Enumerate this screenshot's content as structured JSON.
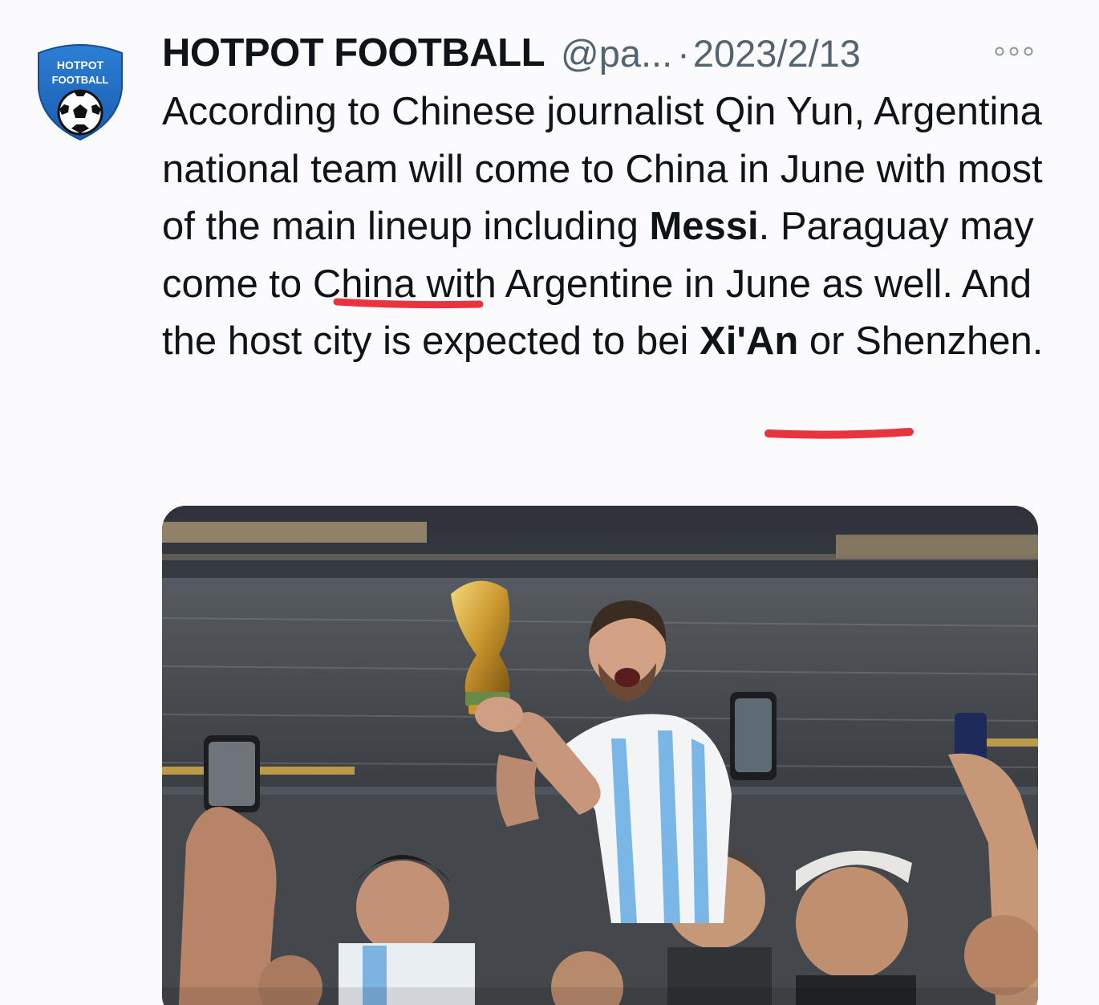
{
  "tweet": {
    "avatar": {
      "line1": "HOTPOT",
      "line2": "FOOTBALL",
      "icon": "soccer-ball-shield-logo"
    },
    "display_name": "HOTPOT FOOTBALL",
    "handle": "@pa...",
    "separator": "·",
    "date": "2023/2/13",
    "more_icon": "more-options-icon",
    "text": {
      "part1": "According to Chinese journalist Qin Yun, Argentina national team will come to China in June with most of the main lineup including ",
      "highlight1": "Messi",
      "part2": ". Paraguay may come to China with Argentine in June as well. And the host city is expected to bei ",
      "highlight2": "Xi'An",
      "part3": " or Shenzhen."
    },
    "underline_color": "#e8343f",
    "media": {
      "description_icon": "photo-celebration-icon"
    }
  }
}
